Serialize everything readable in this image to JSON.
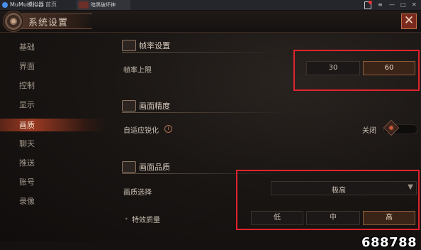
{
  "emulator": {
    "app_title": "MuMu模拟器",
    "home_tab": "首页",
    "game_tab": "暗黑破坏神",
    "controls": [
      "≡",
      "—",
      "□",
      "✕"
    ]
  },
  "header": {
    "title": "系统设置",
    "close_label": "✕"
  },
  "sidebar": {
    "items": [
      {
        "label": "基础"
      },
      {
        "label": "界面"
      },
      {
        "label": "控制"
      },
      {
        "label": "显示"
      },
      {
        "label": "画质"
      },
      {
        "label": "聊天"
      },
      {
        "label": "推送"
      },
      {
        "label": "账号"
      },
      {
        "label": "录像"
      }
    ],
    "active_index": 4
  },
  "frame_rate": {
    "section_title": "帧率设置",
    "limit_label": "帧率上限",
    "options": [
      "30",
      "60"
    ],
    "selected": "60"
  },
  "precision": {
    "section_title": "画面精度",
    "sharpen_label": "自适应锐化",
    "info_icon": "i",
    "toggle_state": "关闭"
  },
  "quality": {
    "section_title": "画面品质",
    "select_label": "画质选择",
    "select_value": "极高",
    "effects_label": "特效质量",
    "effects_options": [
      "低",
      "中",
      "高"
    ],
    "effects_selected": "高"
  },
  "watermark": "688788",
  "colors": {
    "highlight_box": "#e0242e",
    "accent": "#9b3a22"
  }
}
